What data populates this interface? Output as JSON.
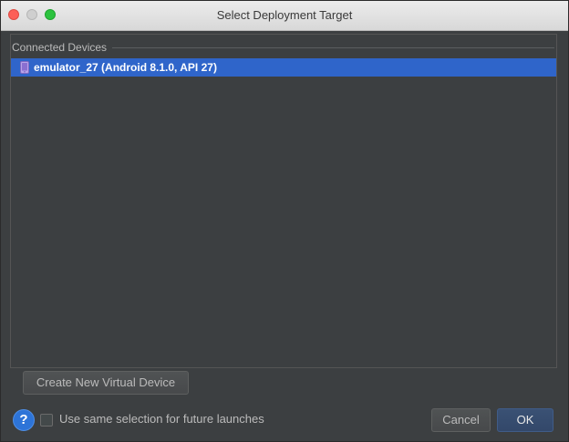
{
  "window": {
    "title": "Select Deployment Target"
  },
  "connected_devices": {
    "label": "Connected Devices",
    "items": [
      {
        "label": "emulator_27 (Android 8.1.0, API 27)",
        "icon": "phone-icon",
        "selected": true
      }
    ]
  },
  "buttons": {
    "create_label": "Create New Virtual Device",
    "cancel_label": "Cancel",
    "ok_label": "OK"
  },
  "footer": {
    "help_glyph": "?",
    "checkbox_label": "Use same selection for future launches",
    "checkbox_checked": false
  },
  "colors": {
    "selection": "#2f65ca",
    "background": "#3c3f41",
    "help": "#2d74d8"
  }
}
